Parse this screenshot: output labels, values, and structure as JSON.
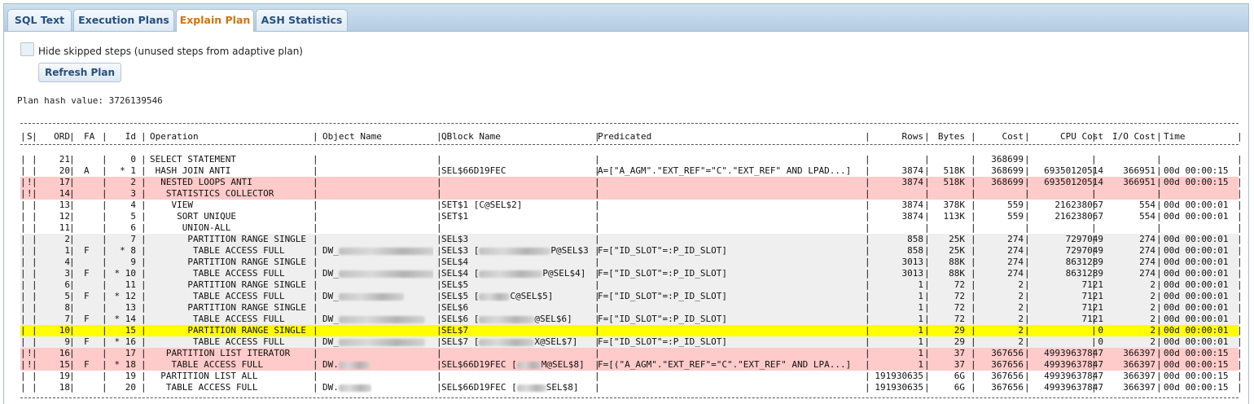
{
  "tabs": [
    {
      "label": "SQL Text",
      "active": false
    },
    {
      "label": "Execution Plans",
      "active": false
    },
    {
      "label": "Explain Plan",
      "active": true
    },
    {
      "label": "ASH Statistics",
      "active": false
    }
  ],
  "options": {
    "hide_skipped_label": "Hide skipped steps (unused steps from adaptive plan)",
    "hide_skipped_checked": false,
    "refresh_label": "Refresh Plan"
  },
  "plan_hash": "Plan hash value: 3726139546",
  "colors": {
    "skipped_row": "#ffcaca",
    "selected_row": "#ffff00",
    "group_row": "#efefef"
  },
  "plan": {
    "headers": {
      "s": "S",
      "ord": "ORD",
      "fa": "FA",
      "id": "Id",
      "operation": "Operation",
      "object": "Object Name",
      "qblock": "QBlock Name",
      "predicated": "Predicated",
      "rows": "Rows",
      "bytes": "Bytes",
      "cost": "Cost",
      "cpu": "CPU Cost",
      "io": "I/O Cost",
      "time": "Time"
    },
    "rows": [
      {
        "s": "",
        "ord": "21",
        "fa": "",
        "id": "0",
        "op": "SELECT STATEMENT",
        "obj": "",
        "qb": "",
        "pred": "",
        "rows": "",
        "bytes": "",
        "cost": "368699",
        "cpu": "",
        "io": "",
        "time": ""
      },
      {
        "s": "",
        "ord": "20",
        "fa": "A",
        "id": "* 1",
        "op": " HASH JOIN ANTI",
        "obj": "",
        "qb": "SEL$66D19FEC",
        "pred": "A=[\"A_AGM\".\"EXT_REF\"=\"C\".\"EXT_REF\" AND LPAD...]",
        "rows": "3874",
        "bytes": "518K",
        "cost": "368699",
        "cpu": "69350120514",
        "io": "366951",
        "time": "00d 00:00:15"
      },
      {
        "s": "!",
        "ord": "17",
        "fa": "",
        "id": "2",
        "op": "  NESTED LOOPS ANTI",
        "obj": "",
        "qb": "",
        "pred": "",
        "rows": "3874",
        "bytes": "518K",
        "cost": "368699",
        "cpu": "69350120514",
        "io": "366951",
        "time": "00d 00:00:15",
        "hl": "red"
      },
      {
        "s": "!",
        "ord": "14",
        "fa": "",
        "id": "3",
        "op": "   STATISTICS COLLECTOR",
        "obj": "",
        "qb": "",
        "pred": "",
        "rows": "",
        "bytes": "",
        "cost": "",
        "cpu": "",
        "io": "",
        "time": "",
        "hl": "red"
      },
      {
        "s": "",
        "ord": "13",
        "fa": "",
        "id": "4",
        "op": "    VIEW",
        "obj": "",
        "qb": "SET$1 [C@SEL$2]",
        "pred": "",
        "rows": "3874",
        "bytes": "378K",
        "cost": "559",
        "cpu": "216238067",
        "io": "554",
        "time": "00d 00:00:01"
      },
      {
        "s": "",
        "ord": "12",
        "fa": "",
        "id": "5",
        "op": "     SORT UNIQUE",
        "obj": "",
        "qb": "SET$1",
        "pred": "",
        "rows": "3874",
        "bytes": "113K",
        "cost": "559",
        "cpu": "216238067",
        "io": "554",
        "time": "00d 00:00:01"
      },
      {
        "s": "",
        "ord": "11",
        "fa": "",
        "id": "6",
        "op": "      UNION-ALL",
        "obj": "",
        "qb": "",
        "pred": "",
        "rows": "",
        "bytes": "",
        "cost": "",
        "cpu": "",
        "io": "",
        "time": ""
      },
      {
        "s": "",
        "ord": "2",
        "fa": "",
        "id": "7",
        "op": "       PARTITION RANGE SINGLE",
        "obj": "",
        "qb": "SEL$3",
        "pred": "",
        "rows": "858",
        "bytes": "25K",
        "cost": "274",
        "cpu": "7297049",
        "io": "274",
        "time": "00d 00:00:01",
        "hl": "grey"
      },
      {
        "s": "",
        "ord": "1",
        "fa": "F",
        "id": "* 8",
        "op": "        TABLE ACCESS FULL",
        "obj": "DW_",
        "obj_blur": 118,
        "qb": "SEL$3 [",
        "qb_blur": 88,
        "qb_tail": "P@SEL$3]",
        "pred": "F=[\"ID_SLOT\"=:P_ID_SLOT]",
        "rows": "858",
        "bytes": "25K",
        "cost": "274",
        "cpu": "7297049",
        "io": "274",
        "time": "00d 00:00:01",
        "hl": "grey"
      },
      {
        "s": "",
        "ord": "4",
        "fa": "",
        "id": "9",
        "op": "       PARTITION RANGE SINGLE",
        "obj": "",
        "qb": "SEL$4",
        "pred": "",
        "rows": "3013",
        "bytes": "88K",
        "cost": "274",
        "cpu": "8631289",
        "io": "274",
        "time": "00d 00:00:01",
        "hl": "grey"
      },
      {
        "s": "",
        "ord": "3",
        "fa": "F",
        "id": "* 10",
        "op": "        TABLE ACCESS FULL",
        "obj": "DW_",
        "obj_blur": 120,
        "qb": "SEL$4 [",
        "qb_blur": 78,
        "qb_tail": "P@SEL$4]",
        "pred": "F=[\"ID_SLOT\"=:P_ID_SLOT]",
        "rows": "3013",
        "bytes": "88K",
        "cost": "274",
        "cpu": "8631289",
        "io": "274",
        "time": "00d 00:00:01",
        "hl": "grey"
      },
      {
        "s": "",
        "ord": "6",
        "fa": "",
        "id": "11",
        "op": "       PARTITION RANGE SINGLE",
        "obj": "",
        "qb": "SEL$5",
        "pred": "",
        "rows": "1",
        "bytes": "72",
        "cost": "2",
        "cpu": "7121",
        "io": "2",
        "time": "00d 00:00:01",
        "hl": "grey"
      },
      {
        "s": "",
        "ord": "5",
        "fa": "F",
        "id": "* 12",
        "op": "        TABLE ACCESS FULL",
        "obj": "DW_",
        "obj_blur": 80,
        "qb": "SEL$5 [",
        "qb_blur": 38,
        "qb_tail": "C@SEL$5]",
        "pred": "F=[\"ID_SLOT\"=:P_ID_SLOT]",
        "rows": "1",
        "bytes": "72",
        "cost": "2",
        "cpu": "7121",
        "io": "2",
        "time": "00d 00:00:01",
        "hl": "grey"
      },
      {
        "s": "",
        "ord": "8",
        "fa": "",
        "id": "13",
        "op": "       PARTITION RANGE SINGLE",
        "obj": "",
        "qb": "SEL$6",
        "pred": "",
        "rows": "1",
        "bytes": "72",
        "cost": "2",
        "cpu": "7121",
        "io": "2",
        "time": "00d 00:00:01",
        "hl": "grey"
      },
      {
        "s": "",
        "ord": "7",
        "fa": "F",
        "id": "* 14",
        "op": "        TABLE ACCESS FULL",
        "obj": "DW_",
        "obj_blur": 106,
        "qb": "SEL$6 [",
        "qb_blur": 68,
        "qb_tail": "@SEL$6]",
        "pred": "F=[\"ID_SLOT\"=:P_ID_SLOT]",
        "rows": "1",
        "bytes": "72",
        "cost": "2",
        "cpu": "7121",
        "io": "2",
        "time": "00d 00:00:01",
        "hl": "grey"
      },
      {
        "s": "",
        "ord": "10",
        "fa": "",
        "id": "15",
        "op": "       PARTITION RANGE SINGLE",
        "obj": "",
        "qb": "SEL$7",
        "pred": "",
        "rows": "1",
        "bytes": "29",
        "cost": "2",
        "cpu": "0",
        "io": "2",
        "time": "00d 00:00:01",
        "hl": "yellow"
      },
      {
        "s": "",
        "ord": "9",
        "fa": "F",
        "id": "* 16",
        "op": "        TABLE ACCESS FULL",
        "obj": "DW_",
        "obj_blur": 106,
        "qb": "SEL$7 [",
        "qb_blur": 68,
        "qb_tail": "X@SEL$7]",
        "pred": "F=[\"ID_SLOT\"=:P_ID_SLOT]",
        "rows": "1",
        "bytes": "29",
        "cost": "2",
        "cpu": "0",
        "io": "2",
        "time": "00d 00:00:01",
        "hl": "grey"
      },
      {
        "s": "!",
        "ord": "16",
        "fa": "",
        "id": "17",
        "op": "   PARTITION LIST ITERATOR",
        "obj": "",
        "qb": "",
        "pred": "",
        "rows": "1",
        "bytes": "37",
        "cost": "367656",
        "cpu": "49939637847",
        "io": "366397",
        "time": "00d 00:00:15",
        "hl": "red"
      },
      {
        "s": "!",
        "ord": "15",
        "fa": "F",
        "id": "* 18",
        "op": "    TABLE ACCESS FULL",
        "obj": "DW.",
        "obj_blur": 38,
        "qb": "SEL$66D19FEC [",
        "qb_blur": 30,
        "qb_tail": "M@SEL$8]",
        "pred": "F=[(\"A_AGM\".\"EXT_REF\"=\"C\".\"EXT_REF\" AND LPA...]",
        "rows": "1",
        "bytes": "37",
        "cost": "367656",
        "cpu": "49939637847",
        "io": "366397",
        "time": "00d 00:00:15",
        "hl": "red"
      },
      {
        "s": "",
        "ord": "19",
        "fa": "",
        "id": "19",
        "op": "  PARTITION LIST ALL",
        "obj": "",
        "qb": "",
        "pred": "",
        "rows": "191930635",
        "bytes": "6G",
        "cost": "367656",
        "cpu": "49939637847",
        "io": "366397",
        "time": "00d 00:00:15"
      },
      {
        "s": "",
        "ord": "18",
        "fa": "",
        "id": "20",
        "op": "   TABLE ACCESS FULL",
        "obj": "DW.",
        "obj_blur": 40,
        "qb": "SEL$66D19FEC [",
        "qb_blur": 36,
        "qb_tail": "SEL$8]",
        "pred": "",
        "rows": "191930635",
        "bytes": "6G",
        "cost": "367656",
        "cpu": "49939637847",
        "io": "366397",
        "time": "00d 00:00:15"
      }
    ]
  }
}
